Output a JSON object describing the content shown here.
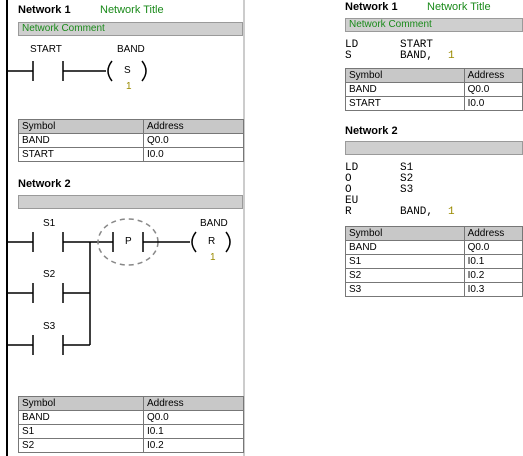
{
  "left": {
    "network1": {
      "title": "Network 1",
      "subtitle": "Network Title",
      "comment": "Network Comment",
      "contact_label": "START",
      "coil_label": "BAND",
      "coil_type": "S",
      "coil_count": "1",
      "symbols": {
        "headers": [
          "Symbol",
          "Address"
        ],
        "rows": [
          [
            "BAND",
            "Q0.0"
          ],
          [
            "START",
            "I0.0"
          ]
        ]
      }
    },
    "network2": {
      "title": "Network 2",
      "contact1": "S1",
      "contact2": "S2",
      "contact3": "S3",
      "edge_label": "P",
      "coil_label": "BAND",
      "coil_type": "R",
      "coil_count": "1",
      "symbols": {
        "headers": [
          "Symbol",
          "Address"
        ],
        "rows": [
          [
            "BAND",
            "Q0.0"
          ],
          [
            "S1",
            "I0.1"
          ],
          [
            "S2",
            "I0.2"
          ]
        ]
      }
    }
  },
  "right": {
    "network1": {
      "title": "Network 1",
      "subtitle": "Network Title",
      "comment": "Network Comment",
      "stl": [
        {
          "op": "LD",
          "arg": "START",
          "num": ""
        },
        {
          "op": "S",
          "arg": "BAND,",
          "num": "1"
        }
      ],
      "symbols": {
        "headers": [
          "Symbol",
          "Address"
        ],
        "rows": [
          [
            "BAND",
            "Q0.0"
          ],
          [
            "START",
            "I0.0"
          ]
        ]
      }
    },
    "network2": {
      "title": "Network 2",
      "stl": [
        {
          "op": "LD",
          "arg": "S1",
          "num": ""
        },
        {
          "op": "O",
          "arg": "S2",
          "num": ""
        },
        {
          "op": "O",
          "arg": "S3",
          "num": ""
        },
        {
          "op": "EU",
          "arg": "",
          "num": ""
        },
        {
          "op": "R",
          "arg": "BAND,",
          "num": "1"
        }
      ],
      "symbols": {
        "headers": [
          "Symbol",
          "Address"
        ],
        "rows": [
          [
            "BAND",
            "Q0.0"
          ],
          [
            "S1",
            "I0.1"
          ],
          [
            "S2",
            "I0.2"
          ],
          [
            "S3",
            "I0.3"
          ]
        ]
      }
    }
  }
}
